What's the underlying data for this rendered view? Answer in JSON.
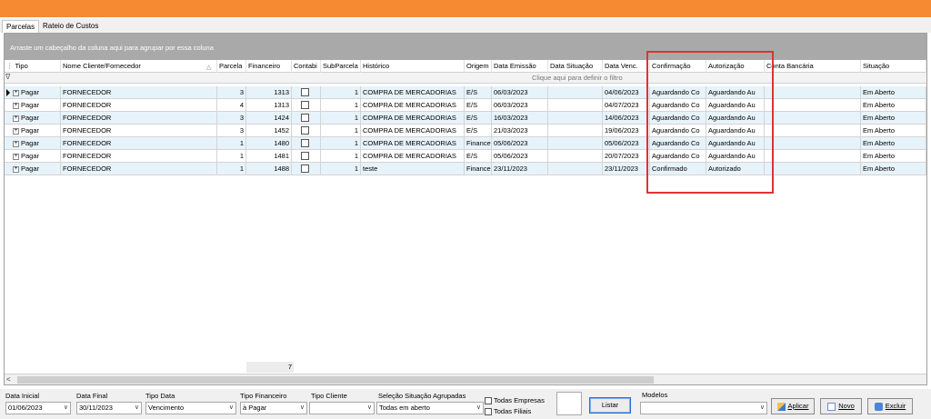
{
  "tabs": [
    {
      "label": "Parcelas"
    },
    {
      "label": "Rateio de Custos"
    }
  ],
  "group_panel_text": "Arraste um cabeçalho da coluna aqui para agrupar por essa coluna",
  "columns": [
    {
      "label": "Tipo"
    },
    {
      "label": "Nome Cliente/Fornecedor"
    },
    {
      "label": "Parcela"
    },
    {
      "label": "Financeiro"
    },
    {
      "label": "Contabi"
    },
    {
      "label": "SubParcela"
    },
    {
      "label": "Histórico"
    },
    {
      "label": "Origem"
    },
    {
      "label": "Data Emissão"
    },
    {
      "label": "Data Situação"
    },
    {
      "label": "Data Venc."
    },
    {
      "label": "Confirmação"
    },
    {
      "label": "Autorização"
    },
    {
      "label": "Conta Bancária"
    },
    {
      "label": "Situação"
    }
  ],
  "filter_hint": "Clique aqui para definir o filtro",
  "rows": [
    {
      "tipo": "Pagar",
      "nome": "FORNECEDOR",
      "parcela": "3",
      "financeiro": "1313",
      "subparcela": "1",
      "historico": "COMPRA DE MERCADORIAS",
      "origem": "E/S",
      "emissao": "06/03/2023",
      "situacao_data": "",
      "venc": "04/06/2023",
      "confirmacao": "Aguardando Co",
      "autorizacao": "Aguardando Au",
      "conta": "",
      "situacao": "Em Aberto"
    },
    {
      "tipo": "Pagar",
      "nome": "FORNECEDOR",
      "parcela": "4",
      "financeiro": "1313",
      "subparcela": "1",
      "historico": "COMPRA DE MERCADORIAS",
      "origem": "E/S",
      "emissao": "06/03/2023",
      "situacao_data": "",
      "venc": "04/07/2023",
      "confirmacao": "Aguardando Co",
      "autorizacao": "Aguardando Au",
      "conta": "",
      "situacao": "Em Aberto"
    },
    {
      "tipo": "Pagar",
      "nome": "FORNECEDOR",
      "parcela": "3",
      "financeiro": "1424",
      "subparcela": "1",
      "historico": "COMPRA DE MERCADORIAS",
      "origem": "E/S",
      "emissao": "16/03/2023",
      "situacao_data": "",
      "venc": "14/06/2023",
      "confirmacao": "Aguardando Co",
      "autorizacao": "Aguardando Au",
      "conta": "",
      "situacao": "Em Aberto"
    },
    {
      "tipo": "Pagar",
      "nome": "FORNECEDOR",
      "parcela": "3",
      "financeiro": "1452",
      "subparcela": "1",
      "historico": "COMPRA DE MERCADORIAS",
      "origem": "E/S",
      "emissao": "21/03/2023",
      "situacao_data": "",
      "venc": "19/06/2023",
      "confirmacao": "Aguardando Co",
      "autorizacao": "Aguardando Au",
      "conta": "",
      "situacao": "Em Aberto"
    },
    {
      "tipo": "Pagar",
      "nome": "FORNECEDOR",
      "parcela": "1",
      "financeiro": "1480",
      "subparcela": "1",
      "historico": "COMPRA DE MERCADORIAS",
      "origem": "Finance",
      "emissao": "05/06/2023",
      "situacao_data": "",
      "venc": "05/06/2023",
      "confirmacao": "Aguardando Co",
      "autorizacao": "Aguardando Au",
      "conta": "",
      "situacao": "Em Aberto"
    },
    {
      "tipo": "Pagar",
      "nome": "FORNECEDOR",
      "parcela": "1",
      "financeiro": "1481",
      "subparcela": "1",
      "historico": "COMPRA DE MERCADORIAS",
      "origem": "E/S",
      "emissao": "05/06/2023",
      "situacao_data": "",
      "venc": "20/07/2023",
      "confirmacao": "Aguardando Co",
      "autorizacao": "Aguardando Au",
      "conta": "",
      "situacao": "Em Aberto"
    },
    {
      "tipo": "Pagar",
      "nome": "FORNECEDOR",
      "parcela": "1",
      "financeiro": "1488",
      "subparcela": "1",
      "historico": "teste",
      "origem": "Finance",
      "emissao": "23/11/2023",
      "situacao_data": "",
      "venc": "23/11/2023",
      "confirmacao": "Confirmado",
      "autorizacao": "Autorizado",
      "conta": "",
      "situacao": "Em Aberto"
    }
  ],
  "summary_count": "7",
  "filters": {
    "data_inicial_label": "Data Inicial",
    "data_inicial_value": "01/06/2023",
    "data_final_label": "Data Final",
    "data_final_value": "30/11/2023",
    "tipo_data_label": "Tipo Data",
    "tipo_data_value": "Vencimento",
    "tipo_financeiro_label": "Tipo Financeiro",
    "tipo_financeiro_value": "à Pagar",
    "tipo_cliente_label": "Tipo Cliente",
    "tipo_cliente_value": "",
    "selecao_label": "Seleção Situação Agrupadas",
    "selecao_value": "Todas em aberto",
    "todas_empresas": "Todas Empresas",
    "todas_filiais": "Todas Filiais",
    "listar": "Listar",
    "modelos_label": "Modelos",
    "modelos_value": "",
    "aplicar": "Aplicar",
    "novo": "Novo",
    "excluir": "Excluir"
  },
  "colors": {
    "topbar": "#f58a33",
    "highlight": "#d33333",
    "group_panel": "#a9a9a9"
  }
}
